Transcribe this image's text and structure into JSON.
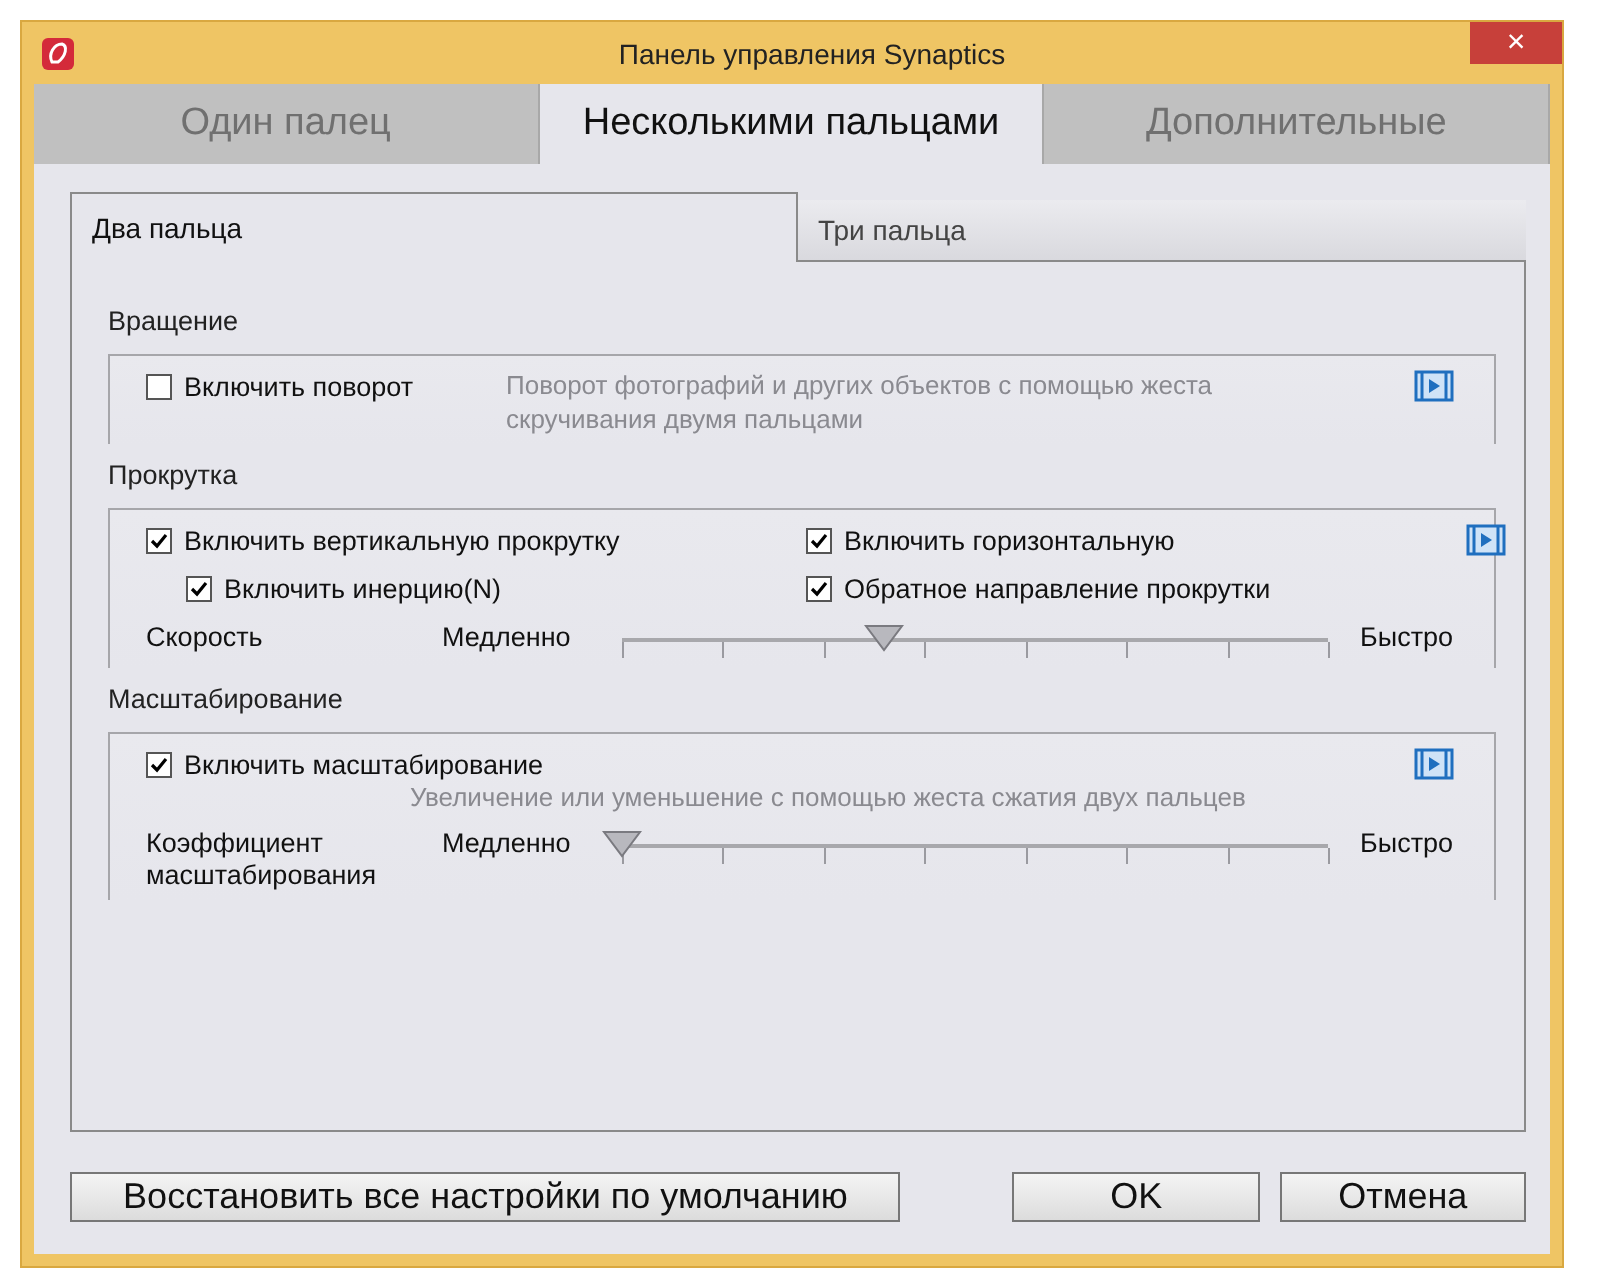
{
  "window": {
    "title": "Панель управления Synaptics",
    "close": "×"
  },
  "tabs": [
    {
      "label": "Один палец",
      "selected": false
    },
    {
      "label": "Несколькими пальцами",
      "selected": true
    },
    {
      "label": "Дополнительные",
      "selected": false
    }
  ],
  "subtabs": [
    {
      "label": "Два пальца",
      "selected": true
    },
    {
      "label": "Три пальца",
      "selected": false
    }
  ],
  "sections": [
    {
      "heading": "Вращение",
      "kind": "beside",
      "description": "Поворот фотографий и других объектов с помощью жеста скручивания двумя пальцами",
      "columns": [
        [
          {
            "label": "Включить поворот",
            "checked": false
          }
        ]
      ]
    },
    {
      "heading": "Прокрутка",
      "columns": [
        [
          {
            "label": "Включить вертикальную прокрутку",
            "checked": true,
            "children": [
              {
                "label": "Включить инерцию(N)",
                "checked": true
              }
            ]
          }
        ],
        [
          {
            "label": "Включить горизонтальную",
            "checked": true
          },
          {
            "label": "Обратное направление прокрутки",
            "checked": true
          }
        ]
      ],
      "slider": {
        "label": "Скорость",
        "min_label": "Медленно",
        "max_label": "Быстро",
        "level": 0.37
      }
    },
    {
      "heading": "Масштабирование",
      "kind": "below",
      "description": "Увеличение или уменьшение с помощью жеста сжатия двух пальцев",
      "columns": [
        [
          {
            "label": "Включить масштабирование",
            "checked": true
          }
        ]
      ],
      "slider": {
        "label": "Коэффициент масштабирования",
        "min_label": "Медленно",
        "max_label": "Быстро",
        "level": 0
      }
    }
  ],
  "buttons": [
    {
      "label": "Восстановить все настройки по умолчанию",
      "kind": "reset"
    },
    {
      "label": "OK",
      "kind": "ok"
    },
    {
      "label": "Отмена",
      "kind": "cancel"
    }
  ]
}
